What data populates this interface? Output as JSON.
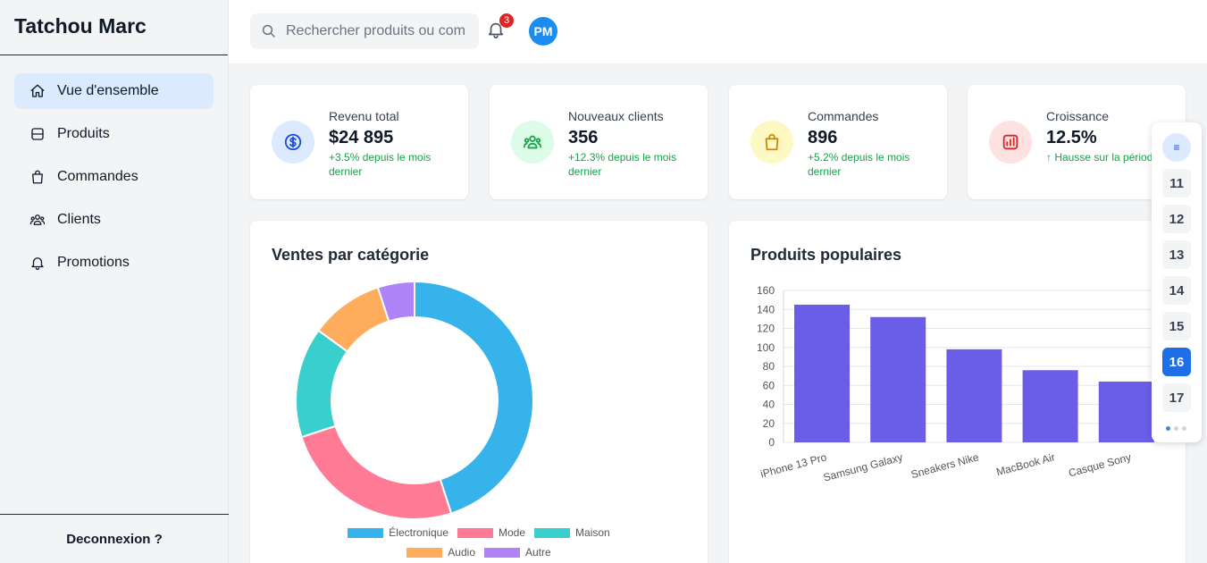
{
  "sidebar": {
    "brand": "Tatchou Marc",
    "items": [
      {
        "label": "Vue d'ensemble",
        "icon": "home-icon"
      },
      {
        "label": "Produits",
        "icon": "box-icon"
      },
      {
        "label": "Commandes",
        "icon": "shopping-bag-icon"
      },
      {
        "label": "Clients",
        "icon": "users-icon"
      },
      {
        "label": "Promotions",
        "icon": "bell-icon"
      }
    ],
    "logout": "Deconnexion ?"
  },
  "topbar": {
    "search_placeholder": "Rechercher produits ou com",
    "notification_count": "3",
    "avatar_initials": "PM"
  },
  "stats": [
    {
      "label": "Revenu total",
      "value": "$24 895",
      "note": "+3.5% depuis le mois dernier",
      "icon": "dollar-icon",
      "bg": "#dbeafe",
      "color": "#1d4ed8"
    },
    {
      "label": "Nouveaux clients",
      "value": "356",
      "note": "+12.3% depuis le mois dernier",
      "icon": "users-icon",
      "bg": "#dcfce7",
      "color": "#16a34a"
    },
    {
      "label": "Commandes",
      "value": "896",
      "note": "+5.2% depuis le mois dernier",
      "icon": "shopping-bag-icon",
      "bg": "#fef9c3",
      "color": "#ca8a04"
    },
    {
      "label": "Croissance",
      "value": "12.5%",
      "note": "↑ Hausse sur la période",
      "icon": "bar-chart-icon",
      "bg": "#fee2e2",
      "color": "#dc2626"
    }
  ],
  "panels": {
    "sales_title": "Ventes par catégorie",
    "products_title": "Produits populaires"
  },
  "pager": {
    "menu_icon": "≡",
    "pages": [
      "11",
      "12",
      "13",
      "14",
      "15",
      "16",
      "17"
    ],
    "active": "16"
  },
  "chart_data": [
    {
      "type": "pie",
      "title": "Ventes par catégorie",
      "categories": [
        "Électronique",
        "Mode",
        "Maison",
        "Audio",
        "Autre"
      ],
      "values": [
        45,
        25,
        15,
        10,
        5
      ],
      "colors": [
        "#36b3eb",
        "#ff7a95",
        "#38cfcc",
        "#ffac5c",
        "#b183f8"
      ],
      "legend": "bottom"
    },
    {
      "type": "bar",
      "title": "Produits populaires",
      "categories": [
        "iPhone 13 Pro",
        "Samsung Galaxy",
        "Sneakers Nike",
        "MacBook Air",
        "Casque Sony"
      ],
      "values": [
        145,
        132,
        98,
        76,
        64
      ],
      "ylim": [
        0,
        160
      ],
      "yticks": [
        0,
        20,
        40,
        60,
        80,
        100,
        120,
        140,
        160
      ],
      "color": "#6a5ee8",
      "grid": true
    }
  ]
}
